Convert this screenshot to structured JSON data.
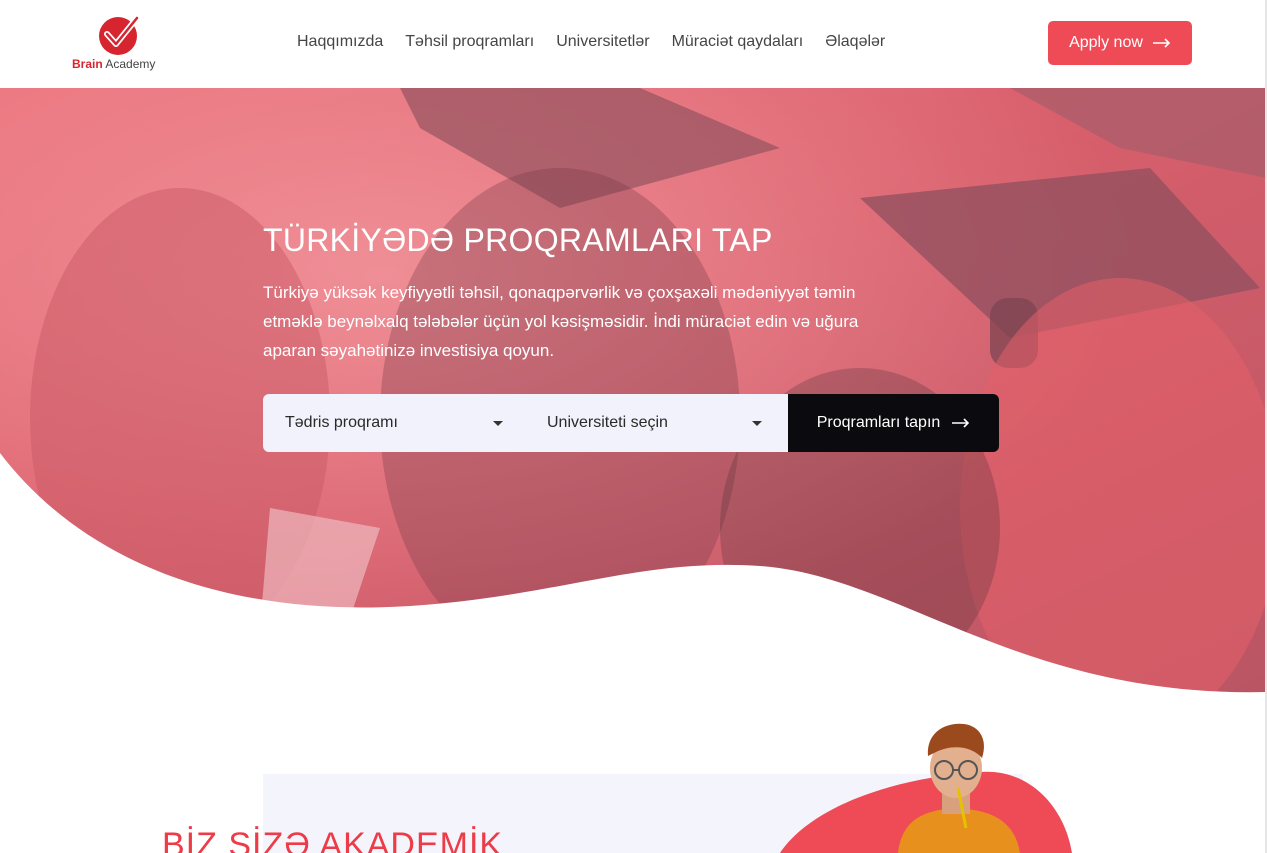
{
  "brand": {
    "name_bold": "Brain",
    "name_light": "Academy"
  },
  "nav": {
    "items": [
      {
        "label": "Haqqımızda"
      },
      {
        "label": "Təhsil proqramları"
      },
      {
        "label": "Universitetlər"
      },
      {
        "label": "Müraciət qaydaları"
      },
      {
        "label": "Əlaqələr"
      }
    ],
    "apply_label": "Apply now"
  },
  "hero": {
    "title": "TÜRKİYƏDƏ PROQRAMLARI TAP",
    "description": "Türkiyə yüksək keyfiyyətli təhsil, qonaqpərvərlik və çoxşaxəli mədəniyyət təmin etməklə beynəlxalq tələbələr üçün yol kəsişməsidir. İndi müraciət edin və uğura aparan səyahətinizə investisiya qoyun."
  },
  "search": {
    "program_select": "Tədris proqramı",
    "university_select": "Universiteti seçin",
    "submit_label": "Proqramları tapın"
  },
  "about": {
    "title": "BİZ SİZƏ AKADEMİK"
  },
  "colors": {
    "accent": "#ee4b57",
    "brand_red": "#d7252f",
    "dark_button": "#0b0b0f",
    "select_bg": "#f1f2fb"
  },
  "icons": [
    "brain-academy-logo-icon",
    "arrow-right-icon",
    "caret-down-icon"
  ]
}
